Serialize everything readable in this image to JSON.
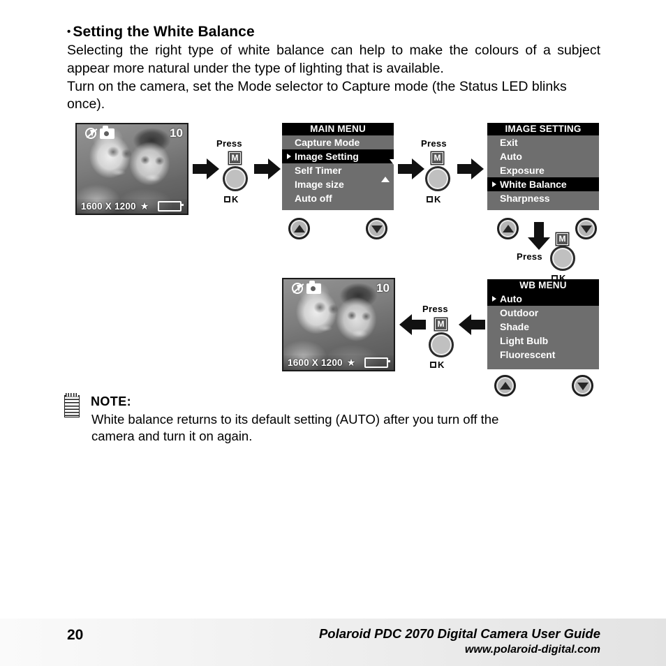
{
  "heading": {
    "bullet": "•",
    "text": "Setting the White Balance"
  },
  "intro": {
    "line1": "Selecting the right type of white balance can help to make the colours of a subject appear more natural under the type of lighting that is available.",
    "line2": "Turn on the camera, set the Mode selector to Capture mode (the Status LED blinks once)."
  },
  "lcd_top": {
    "count": "10",
    "resolution": "1600 X 1200",
    "star": "★"
  },
  "lcd_bottom": {
    "count": "10",
    "resolution": "1600 X 1200",
    "star": "★"
  },
  "main_menu": {
    "title": "MAIN MENU",
    "items": [
      {
        "label": "Capture Mode",
        "selected": false
      },
      {
        "label": "Image Setting",
        "selected": true
      },
      {
        "label": "Self Timer",
        "selected": false
      },
      {
        "label": "Image size",
        "selected": false
      },
      {
        "label": "Auto off",
        "selected": false
      }
    ]
  },
  "image_setting_menu": {
    "title": "IMAGE SETTING",
    "items": [
      {
        "label": "Exit",
        "selected": false
      },
      {
        "label": "Auto",
        "selected": false
      },
      {
        "label": "Exposure",
        "selected": false
      },
      {
        "label": "White Balance",
        "selected": true
      },
      {
        "label": "Sharpness",
        "selected": false
      }
    ]
  },
  "wb_menu": {
    "title": "WB MENU",
    "items": [
      {
        "label": "Auto",
        "selected": true
      },
      {
        "label": "Outdoor",
        "selected": false
      },
      {
        "label": "Shade",
        "selected": false
      },
      {
        "label": "Light Bulb",
        "selected": false
      },
      {
        "label": "Fluorescent",
        "selected": false
      }
    ]
  },
  "press_buttons": {
    "press_label": "Press",
    "m_label": "M",
    "ok_label": "K"
  },
  "note": {
    "title": "NOTE:",
    "line1": "White balance returns to its default setting (AUTO) after you turn off the",
    "line2": "camera and turn it on again."
  },
  "footer": {
    "page_number": "20",
    "title": "Polaroid PDC 2070 Digital Camera User Guide",
    "url": "www.polaroid-digital.com"
  },
  "colors": {
    "menu_background": "#6e6e6e",
    "menu_title_bar": "#000000",
    "menu_selected": "#000000",
    "menu_text": "#ffffff",
    "footer_background": "#f0f0f0",
    "ink": "#000000"
  }
}
